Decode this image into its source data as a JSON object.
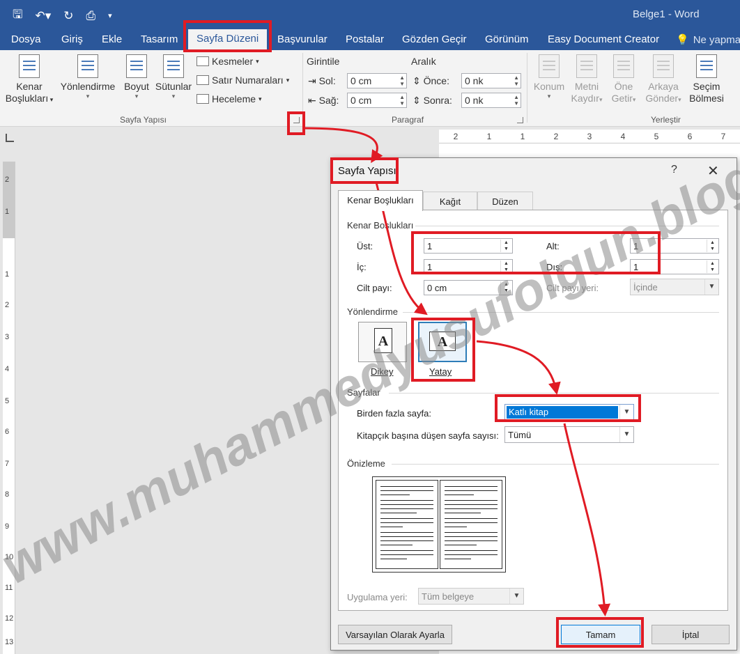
{
  "window": {
    "title": "Belge1 - Word"
  },
  "tabs": [
    {
      "label": "Dosya"
    },
    {
      "label": "Giriş"
    },
    {
      "label": "Ekle"
    },
    {
      "label": "Tasarım"
    },
    {
      "label": "Sayfa Düzeni"
    },
    {
      "label": "Başvurular"
    },
    {
      "label": "Postalar"
    },
    {
      "label": "Gözden Geçir"
    },
    {
      "label": "Görünüm"
    },
    {
      "label": "Easy Document Creator"
    },
    {
      "label": "Ne yapmak"
    }
  ],
  "ribbon": {
    "page_setup": {
      "margins": [
        "Kenar",
        "Boşlukları"
      ],
      "orientation": "Yönlendirme",
      "size": "Boyut",
      "columns": "Sütunlar",
      "breaks": "Kesmeler",
      "line_numbers": "Satır Numaraları",
      "hyphenation": "Heceleme",
      "group_label": "Sayfa Yapısı"
    },
    "paragraph": {
      "indent": "Girintile",
      "spacing": "Aralık",
      "left_label": "Sol:",
      "left_value": "0 cm",
      "right_label": "Sağ:",
      "right_value": "0 cm",
      "before_label": "Önce:",
      "before_value": "0 nk",
      "after_label": "Sonra:",
      "after_value": "0 nk",
      "group_label": "Paragraf"
    },
    "arrange": {
      "position": "Konum",
      "wrap": [
        "Metni",
        "Kaydır"
      ],
      "forward": [
        "Öne",
        "Getir"
      ],
      "backward": [
        "Arkaya",
        "Gönder"
      ],
      "selection_pane": [
        "Seçim",
        "Bölmesi"
      ],
      "group_label": "Yerleştir"
    }
  },
  "ruler_top": [
    "2",
    "1",
    "1",
    "2",
    "3",
    "4",
    "5",
    "6",
    "7"
  ],
  "ruler_left": [
    "2",
    "1",
    "1",
    "2",
    "3",
    "4",
    "5",
    "6",
    "7",
    "8",
    "9",
    "10",
    "11",
    "12",
    "13"
  ],
  "dialog": {
    "title": "Sayfa Yapısı",
    "help": "?",
    "close": "✕",
    "tabs": [
      "Kenar Boşlukları",
      "Kağıt",
      "Düzen"
    ],
    "margins_section": "Kenar Boşlukları",
    "top_label": "Üst:",
    "top_value": "1",
    "bottom_label": "Alt:",
    "bottom_value": "1",
    "inside_label": "İç:",
    "inside_value": "1",
    "outside_label": "Dış:",
    "outside_value": "1",
    "gutter_label": "Cilt payı:",
    "gutter_value": "0 cm",
    "gutter_pos_label": "Cilt payı yeri:",
    "gutter_pos_value": "İçinde",
    "orientation_section": "Yönlendirme",
    "portrait": "Dikey",
    "landscape": "Yatay",
    "pages_section": "Sayfalar",
    "multiple_pages_label": "Birden fazla sayfa:",
    "multiple_pages_value": "Katlı kitap",
    "sheets_label": "Kitapçık başına düşen sayfa sayısı:",
    "sheets_value": "Tümü",
    "preview_section": "Önizleme",
    "apply_label": "Uygulama yeri:",
    "apply_value": "Tüm belgeye",
    "default_button": "Varsayılan Olarak Ayarla",
    "ok_button": "Tamam",
    "cancel_button": "İptal"
  },
  "watermark": "www.muhammedyusufolgun.blogspot.com",
  "colors": {
    "word_blue": "#2b579a",
    "annotation_red": "#e01b24",
    "selection_blue": "#0078d7"
  }
}
